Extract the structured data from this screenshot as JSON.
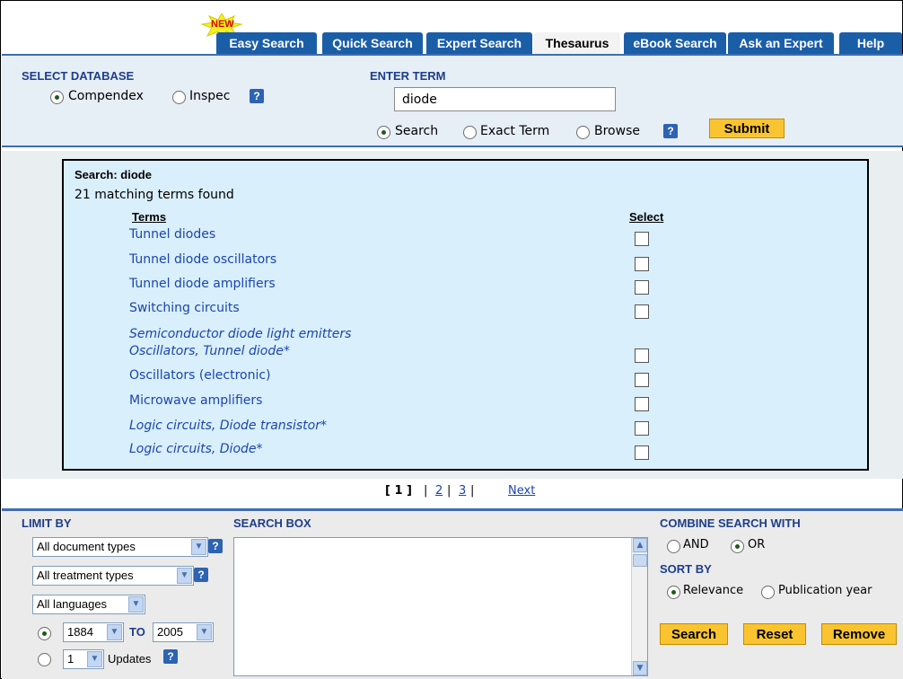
{
  "tabs": {
    "new_badge": "NEW",
    "items": [
      "Easy Search",
      "Quick Search",
      "Expert Search",
      "Thesaurus",
      "eBook Search",
      "Ask an Expert",
      "Help"
    ],
    "active": "Thesaurus"
  },
  "select_database": {
    "label": "SELECT DATABASE",
    "options": [
      "Compendex",
      "Inspec"
    ],
    "selected": "Compendex"
  },
  "enter_term": {
    "label": "ENTER TERM",
    "value": "diode",
    "modes": [
      "Search",
      "Exact Term",
      "Browse"
    ],
    "selected_mode": "Search",
    "submit": "Submit"
  },
  "results": {
    "search_label": "Search: diode",
    "count_text": "21 matching terms found",
    "terms_header": "Terms",
    "select_header": "Select",
    "rows": [
      {
        "term": "Tunnel diodes",
        "italic": false,
        "checkbox": true
      },
      {
        "term": "Tunnel diode oscillators",
        "italic": false,
        "checkbox": true
      },
      {
        "term": "Tunnel diode amplifiers",
        "italic": false,
        "checkbox": true
      },
      {
        "term": "Switching circuits",
        "italic": false,
        "checkbox": true
      },
      {
        "term": "Semiconductor diode light emitters",
        "italic": true,
        "checkbox": false
      },
      {
        "term": "Oscillators, Tunnel diode*",
        "italic": true,
        "checkbox": true
      },
      {
        "term": "Oscillators (electronic)",
        "italic": false,
        "checkbox": true
      },
      {
        "term": "Microwave amplifiers",
        "italic": false,
        "checkbox": true
      },
      {
        "term": "Logic circuits, Diode transistor*",
        "italic": true,
        "checkbox": true
      },
      {
        "term": "Logic circuits, Diode*",
        "italic": true,
        "checkbox": true
      }
    ]
  },
  "pagination": {
    "current": "[ 1 ]",
    "sep": "|",
    "pages": [
      "2",
      "3"
    ],
    "next": "Next"
  },
  "limit_by": {
    "label": "LIMIT BY",
    "doc_types": "All document types",
    "treatment_types": "All treatment types",
    "languages": "All languages",
    "year_from": "1884",
    "to_label": "TO",
    "year_to": "2005",
    "updates_value": "1",
    "updates_label": "Updates"
  },
  "search_box": {
    "label": "SEARCH BOX",
    "value": ""
  },
  "combine": {
    "label": "COMBINE SEARCH WITH",
    "options": [
      "AND",
      "OR"
    ],
    "selected": "OR"
  },
  "sort_by": {
    "label": "SORT BY",
    "options": [
      "Relevance",
      "Publication year"
    ],
    "selected": "Relevance"
  },
  "buttons": {
    "search": "Search",
    "reset": "Reset",
    "remove": "Remove"
  },
  "colors": {
    "tab_blue": "#1b5ea8",
    "accent_yellow": "#f9c430",
    "link_blue": "#1b45b0",
    "results_bg": "#d9effb"
  }
}
